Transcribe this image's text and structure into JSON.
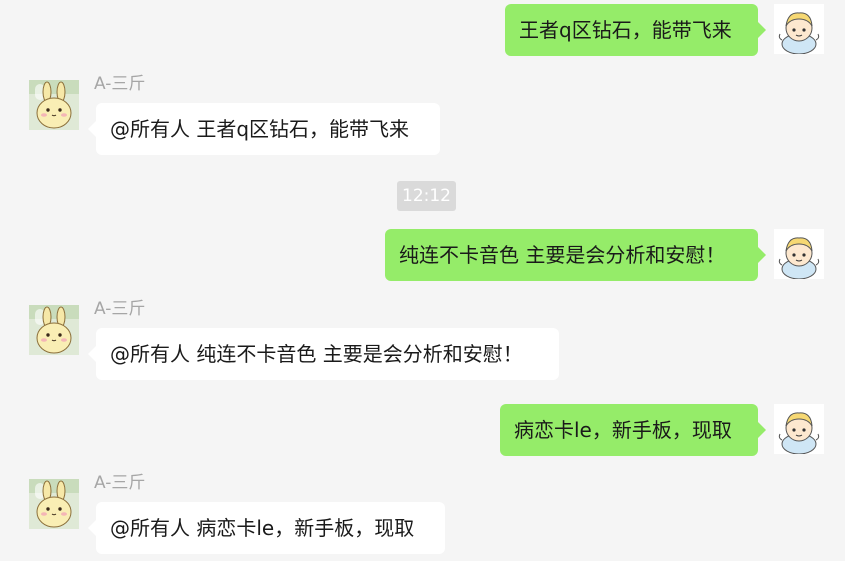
{
  "chat": {
    "timestamp": "12:12",
    "messages": [
      {
        "from": "self",
        "text": "王者q区钻石，能带飞来"
      },
      {
        "from": "other",
        "sender": "A-三斤",
        "text": "@所有人 王者q区钻石，能带飞来"
      },
      {
        "from": "self",
        "text": "纯连不卡音色 主要是会分析和安慰！"
      },
      {
        "from": "other",
        "sender": "A-三斤",
        "text": "@所有人 纯连不卡音色 主要是会分析和安慰！"
      },
      {
        "from": "self",
        "text": "病恋卡le，新手板，现取"
      },
      {
        "from": "other",
        "sender": "A-三斤",
        "text": "@所有人 病恋卡le，新手板，现取"
      }
    ]
  },
  "colors": {
    "background": "#f5f5f5",
    "outgoing_bubble": "#95ec69",
    "incoming_bubble": "#ffffff",
    "sender_name": "#a6a6a6",
    "timestamp_bg": "#dadada"
  }
}
